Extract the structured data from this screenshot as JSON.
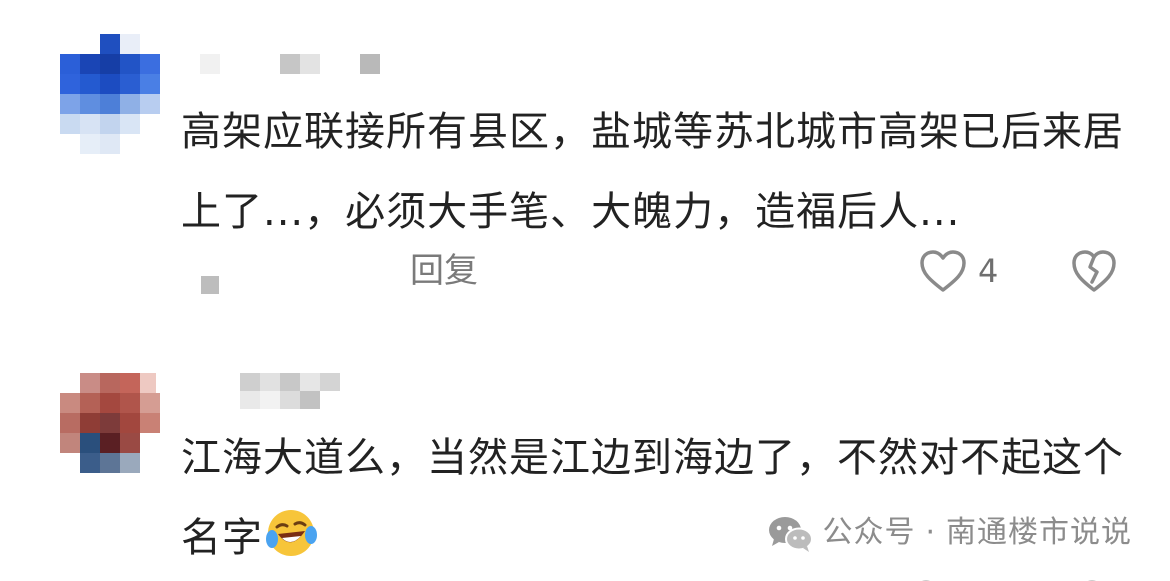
{
  "comments": [
    {
      "text": "高架应联接所有县区，盐城等苏北城市高架已后来居上了...，必须大手笔、大魄力，造福后人...",
      "reply_label": "回复",
      "like_count": "4"
    },
    {
      "text": "江海大道么，当然是江边到海边了，不然对不起这个名字",
      "emoji": "face-rolling-laughing-emoji"
    }
  ],
  "watermark": {
    "platform": "公众号",
    "separator": "·",
    "account": "南通楼市说说"
  },
  "colors": {
    "text": "#222222",
    "meta": "#7a7a7a",
    "icon": "#8a8a8a",
    "watermark": "#8c8c8c"
  },
  "icons": [
    "heart-outline-icon",
    "broken-heart-icon",
    "wechat-logo-icon",
    "face-rolling-laughing-emoji"
  ]
}
